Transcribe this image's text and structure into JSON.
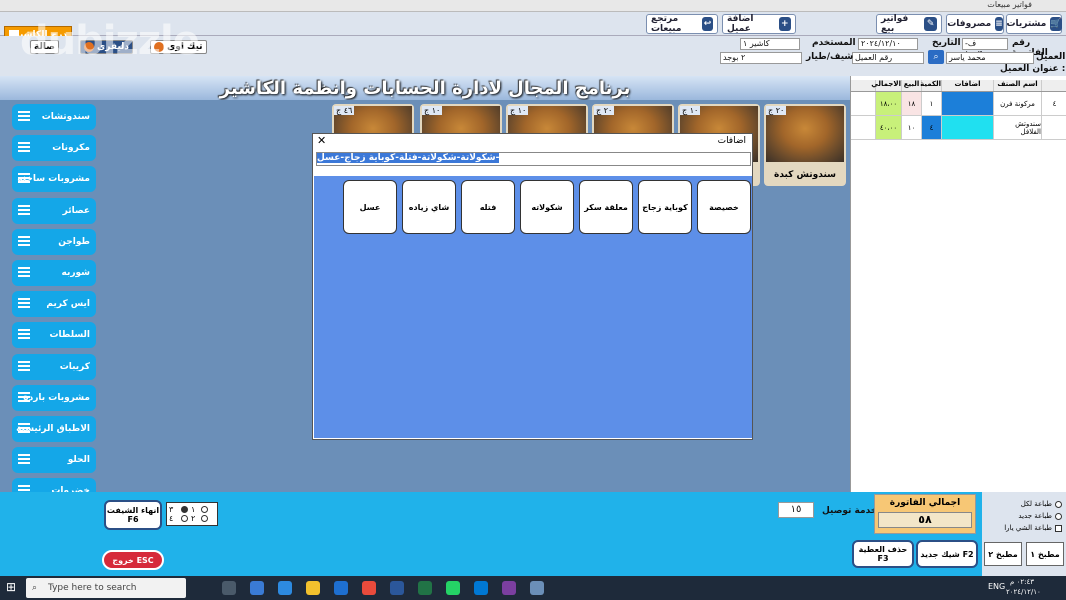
{
  "window": {
    "title": "فواتير مبيعات"
  },
  "toolbar": {
    "purchases": "مشتريات",
    "expenses": "مصروفات",
    "sales_invoices": "فواتير بيع",
    "add_customer": "اضافة عميل",
    "sales_returns": "مرتجع مبيعات",
    "cash_drawer": "درج الكاشير"
  },
  "info": {
    "invoice_no_label": "رقم الفاتورة",
    "invoice_no": "ف-ع-١٠٠٣٠",
    "date_label": "التاريخ",
    "date": "٢٠٢٤/١٢/١٠",
    "user_label": "المستخدم",
    "user": "كاشير ١",
    "customer_label": "العميل",
    "customer": "محمد ياسر",
    "customer_no_placeholder": "رقم العميل",
    "captain_label": "شيف/طيار",
    "captain": "٢ بوجد",
    "address_label": "عنوان العميل :"
  },
  "order_types": {
    "hall": "صالة",
    "takeaway": "تيك اوى",
    "delivery": "دليفرى"
  },
  "watermark": "dubizzle",
  "banner": "برنامج المجال لادارة الحسابات وانظمة الكاشير",
  "categories": [
    "سندوتشات",
    "مكرونات",
    "مشروبات ساخنه",
    "عصائر",
    "طواجن",
    "شوربه",
    "ايس كريم",
    "السلطات",
    "كريبات",
    "مشروبات باردة",
    "الاطباق الرئيسية",
    "الحلو",
    "خضروات",
    "خامات تظيف",
    "خبز"
  ],
  "products": [
    {
      "price": "٢٠ ج",
      "name": "سندوتش كبدة"
    },
    {
      "price": "١٠ ج",
      "name": ""
    },
    {
      "price": "٢٠ ج",
      "name": ""
    },
    {
      "price": "١٠ ج",
      "name": ""
    },
    {
      "price": "١٠ ج",
      "name": ""
    },
    {
      "price": "٤٦ ج",
      "name": ""
    }
  ],
  "grid": {
    "headers": [
      "اسم الصنف",
      "اضافات",
      "الكمية",
      "البيع",
      "الاجمالي"
    ],
    "rows": [
      {
        "num": "٤",
        "name": "مركونة فرن",
        "qty": "١",
        "price": "١٨",
        "total": "١٨،٠٠"
      },
      {
        "num": "",
        "name": "سندوتش الفلافل",
        "qty": "٤",
        "price": "١٠",
        "total": "٤٠،٠٠"
      }
    ]
  },
  "dialog": {
    "title": "اضافات",
    "text": "شكولاتة-شكولاتة-فتلة-كوباية زجاج-عسل-",
    "options": [
      "خصيصة",
      "كوباية زجاج",
      "معلقة سكر",
      "شكولاته",
      "فتله",
      "شاي زياده",
      "عسل"
    ]
  },
  "footer": {
    "delivery_label": "خدمة توصيل",
    "delivery_value": "١٥",
    "total_label": "اجمالي الفاتورة",
    "total_value": "٥٨",
    "end_shift": "انهاء الشيفت F6",
    "exit": "خروج ESC",
    "delete_item": "حذف العطية F3",
    "new_shift": "شيك جديد F2",
    "kitchen1": "مطبخ ١",
    "kitchen2": "مطبخ ٢",
    "print_kitchen": "طباعة لكل",
    "print_new": "طباعة جديد",
    "print_bill": "طباعة الشي يارا"
  },
  "taskbar": {
    "search_placeholder": "Type here to search",
    "lang": "ENG",
    "time": "٠٢:٤٣ م",
    "date": "٢٠٢٤/١٢/١٠"
  }
}
